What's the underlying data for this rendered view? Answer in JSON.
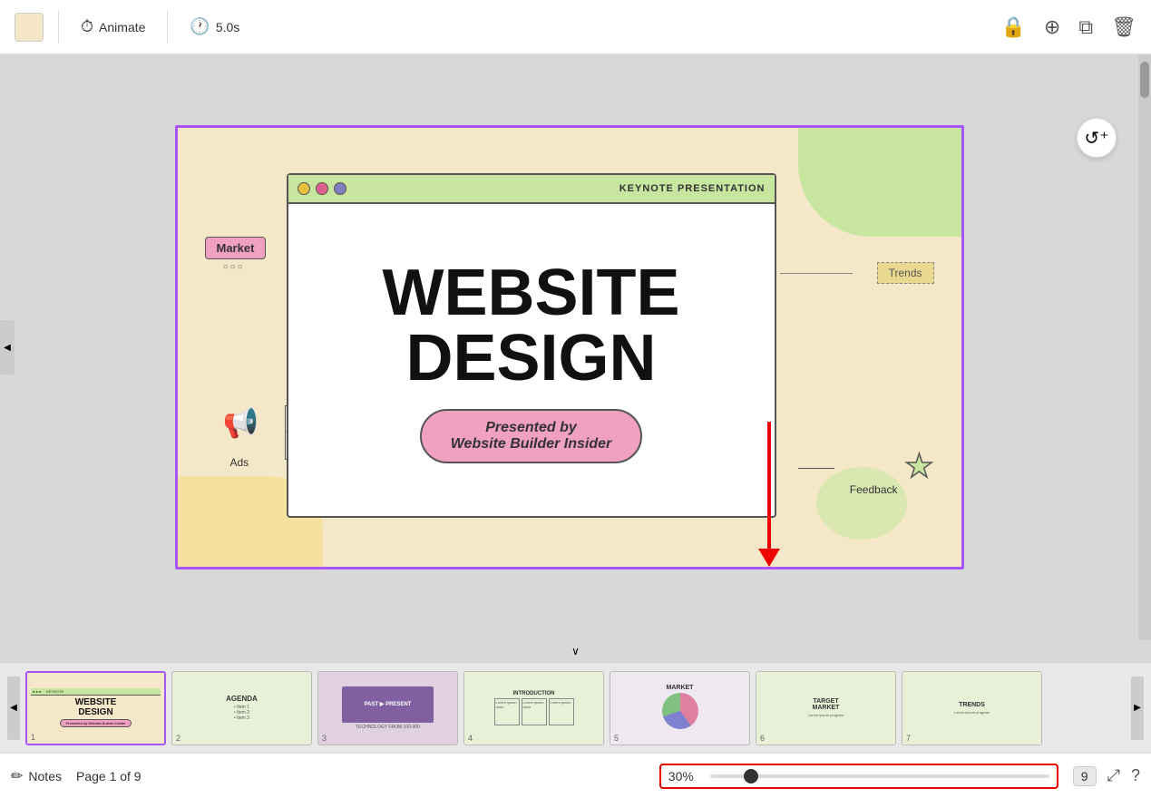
{
  "toolbar": {
    "animate_label": "Animate",
    "duration_label": "5.0s",
    "lock_icon": "🔒",
    "add_icon": "⊕",
    "duplicate_icon": "⧉",
    "delete_icon": "🗑"
  },
  "canvas": {
    "slide_title_line1": "WEBSITE",
    "slide_title_line2": "DESIGN",
    "presented_by": "Presented by\nWebsite Builder Insider",
    "browser_title": "KEYNOTE PRESENTATION",
    "label_market": "Market",
    "label_ads": "Ads",
    "label_trends": "Trends",
    "label_feedback": "Feedback"
  },
  "filmstrip": {
    "slides": [
      {
        "num": "1",
        "label": "WEBSITE DESIGN",
        "type": "title"
      },
      {
        "num": "2",
        "label": "AGENDA",
        "type": "agenda"
      },
      {
        "num": "3",
        "label": "PAST PRESENT",
        "type": "image"
      },
      {
        "num": "4",
        "label": "INTRODUCTION",
        "type": "intro"
      },
      {
        "num": "5",
        "label": "MARKET",
        "type": "chart"
      },
      {
        "num": "6",
        "label": "TARGET MARKET",
        "type": "target"
      },
      {
        "num": "7",
        "label": "TRENDS",
        "type": "trends"
      }
    ]
  },
  "bottom_bar": {
    "notes_label": "Notes",
    "page_info": "Page 1 of 9",
    "zoom_percent": "30%",
    "page_count": "9"
  },
  "refresh_btn": "↻"
}
